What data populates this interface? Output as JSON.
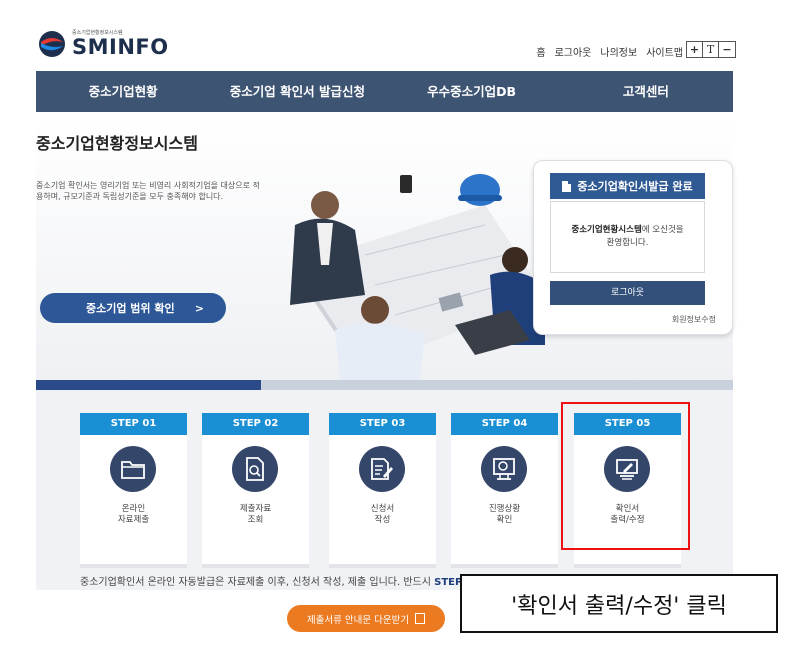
{
  "header": {
    "logo_small": "중소기업현황정보시스템",
    "logo_main": "SMINFO",
    "util_links": [
      "홈",
      "로그아웃",
      "나의정보",
      "사이트맵"
    ],
    "font_controls": [
      "+",
      "T",
      "−"
    ]
  },
  "nav": {
    "items": [
      "중소기업현황",
      "중소기업 확인서 발급신청",
      "우수중소기업DB",
      "고객센터"
    ]
  },
  "hero": {
    "title": "중소기업현황정보시스템",
    "description": "중소기업 확인서는 영리기업 또는 비영리 사회적기업을 대상으로 적용하며, 규모기준과 독립성기준을 모두 충족해야 합니다.",
    "range_button": "중소기업 범위 확인",
    "range_arrow": ">"
  },
  "login_box": {
    "header": "중소기업확인서발급 완료",
    "welcome_bold": "중소기업현황시스템",
    "welcome_rest": "에 오신것을",
    "welcome_line2": "환영합니다.",
    "logout": "로그아웃",
    "edit_info": "회원정보수정"
  },
  "steps": [
    {
      "head": "STEP 01",
      "line1": "온라인",
      "line2": "자료제출",
      "icon": "folder-icon"
    },
    {
      "head": "STEP 02",
      "line1": "제출자료",
      "line2": "조회",
      "icon": "document-search-icon"
    },
    {
      "head": "STEP 03",
      "line1": "신청서",
      "line2": "작성",
      "icon": "document-edit-icon"
    },
    {
      "head": "STEP 04",
      "line1": "진행상황",
      "line2": "확인",
      "icon": "monitor-search-icon"
    },
    {
      "head": "STEP 05",
      "line1": "확인서",
      "line2": "출력/수정",
      "icon": "print-edit-icon"
    }
  ],
  "notice": {
    "text": "중소기업확인서 온라인 자동발급은 자료제출 이후, 신청서 작성, 제출 입니다. 반드시 ",
    "bold": "STEP"
  },
  "download_button": "제출서류 안내문 다운받기",
  "callout": "'확인서 출력/수정' 클릭",
  "colors": {
    "nav_bg": "#3e5473",
    "step_head": "#1a8fd3",
    "step_circle": "#34476a",
    "accent_orange": "#ec7a21",
    "highlight": "#e11111"
  }
}
